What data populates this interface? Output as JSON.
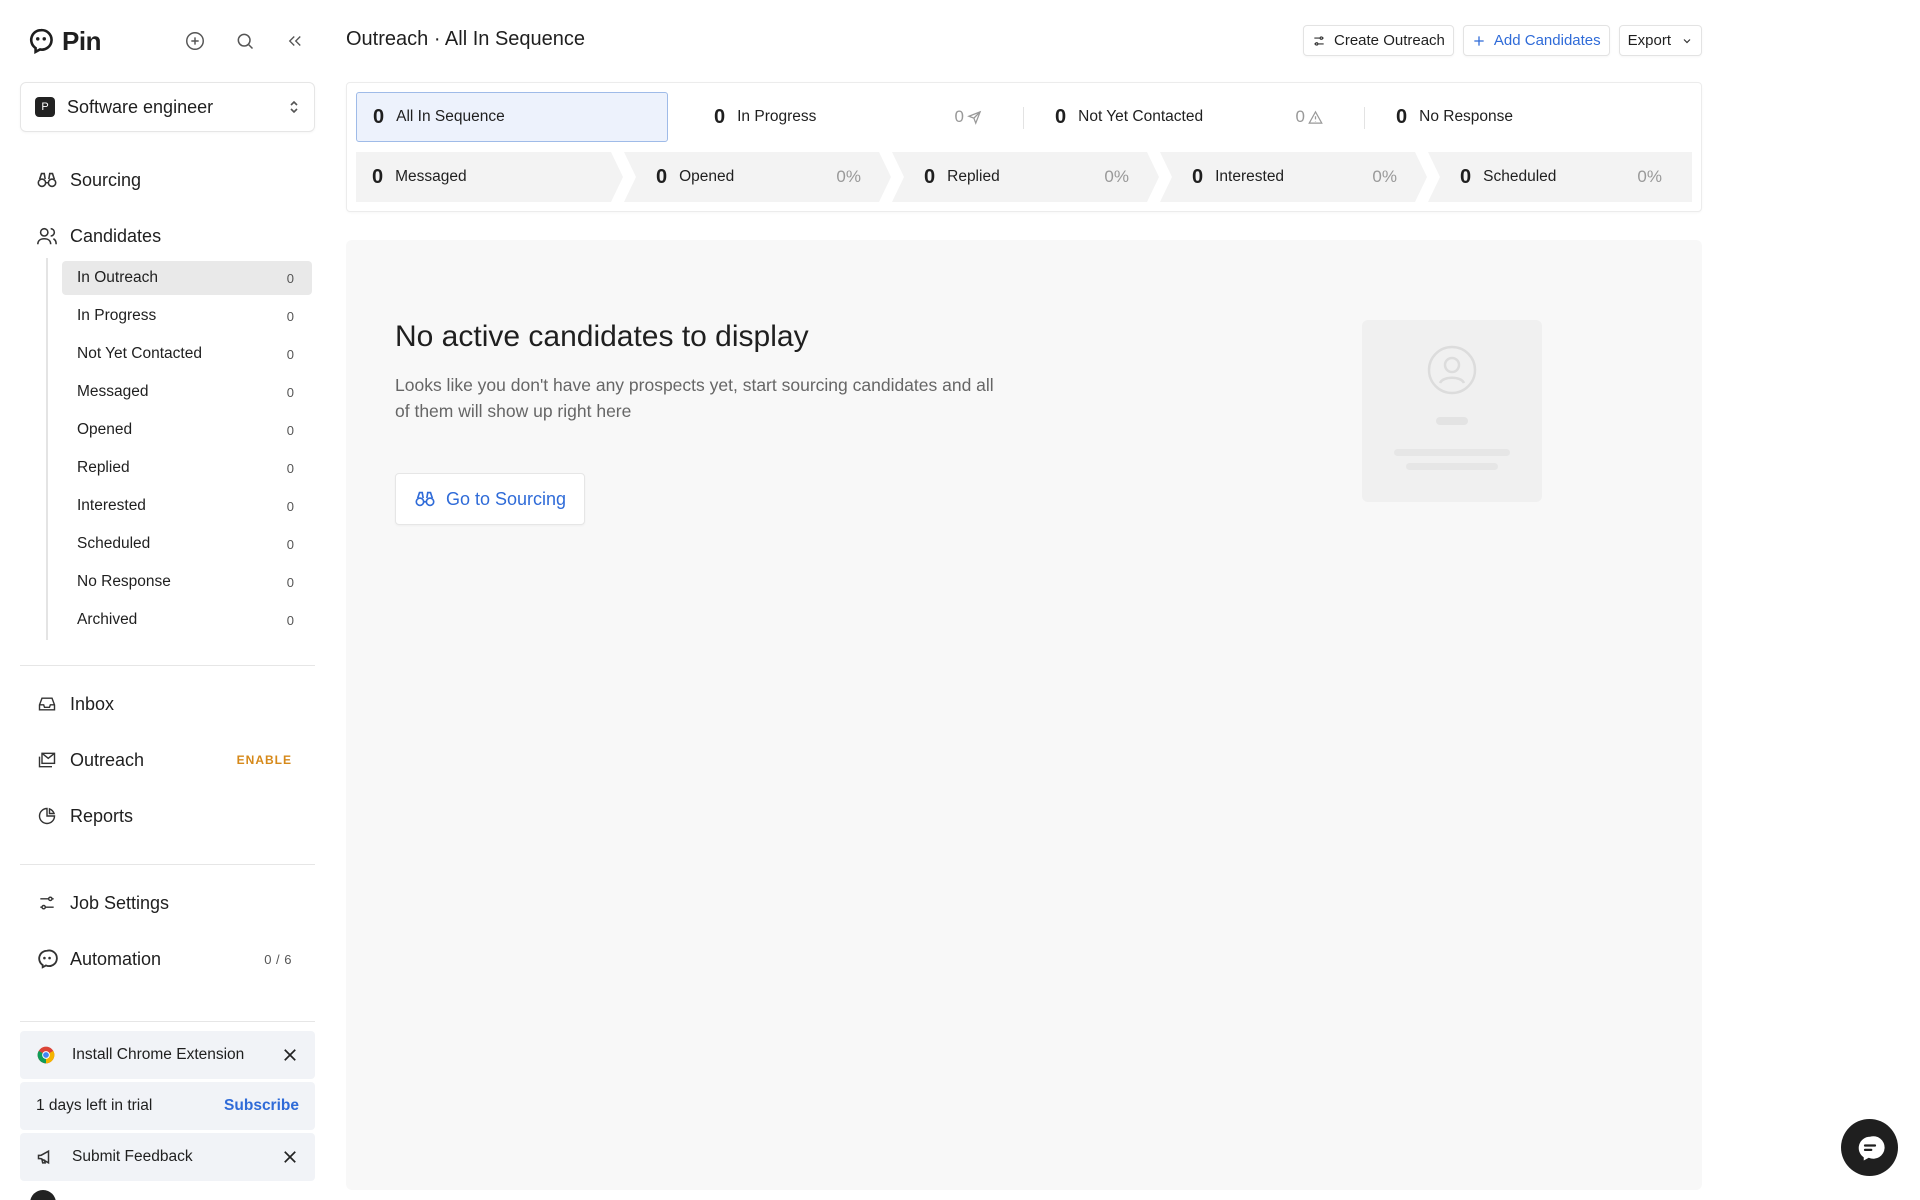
{
  "app": {
    "name": "Pin"
  },
  "job": {
    "badge": "P",
    "name": "Software engineer"
  },
  "nav": {
    "sourcing": "Sourcing",
    "candidates": "Candidates",
    "inbox": "Inbox",
    "outreach": "Outreach",
    "outreach_badge": "ENABLE",
    "reports": "Reports",
    "job_settings": "Job Settings",
    "automation": "Automation",
    "automation_meta": "0 / 6"
  },
  "candidate_filters": [
    {
      "label": "In Outreach",
      "count": "0",
      "active": true
    },
    {
      "label": "In Progress",
      "count": "0"
    },
    {
      "label": "Not Yet Contacted",
      "count": "0"
    },
    {
      "label": "Messaged",
      "count": "0"
    },
    {
      "label": "Opened",
      "count": "0"
    },
    {
      "label": "Replied",
      "count": "0"
    },
    {
      "label": "Interested",
      "count": "0"
    },
    {
      "label": "Scheduled",
      "count": "0"
    },
    {
      "label": "No Response",
      "count": "0"
    },
    {
      "label": "Archived",
      "count": "0"
    }
  ],
  "promos": {
    "chrome": "Install Chrome Extension",
    "trial": "1 days left in trial",
    "subscribe": "Subscribe",
    "feedback": "Submit Feedback"
  },
  "header": {
    "title": "Outreach · All In Sequence",
    "create_outreach": "Create Outreach",
    "add_candidates": "Add Candidates",
    "export": "Export"
  },
  "tabs": [
    {
      "num": "0",
      "label": "All In Sequence",
      "meta": ""
    },
    {
      "num": "0",
      "label": "In Progress",
      "meta": "0"
    },
    {
      "num": "0",
      "label": "Not Yet Contacted",
      "meta": "0"
    },
    {
      "num": "0",
      "label": "No Response",
      "meta": ""
    }
  ],
  "funnel": [
    {
      "num": "0",
      "label": "Messaged",
      "pct": ""
    },
    {
      "num": "0",
      "label": "Opened",
      "pct": "0%"
    },
    {
      "num": "0",
      "label": "Replied",
      "pct": "0%"
    },
    {
      "num": "0",
      "label": "Interested",
      "pct": "0%"
    },
    {
      "num": "0",
      "label": "Scheduled",
      "pct": "0%"
    }
  ],
  "empty": {
    "title": "No active candidates to display",
    "desc": "Looks like you don't have any prospects yet, start sourcing candidates and all of them will show up right here",
    "button": "Go to Sourcing"
  },
  "colors": {
    "accent": "#2f6bd8",
    "enable": "#d6891a",
    "active_tab_bg": "#edf2fc"
  }
}
